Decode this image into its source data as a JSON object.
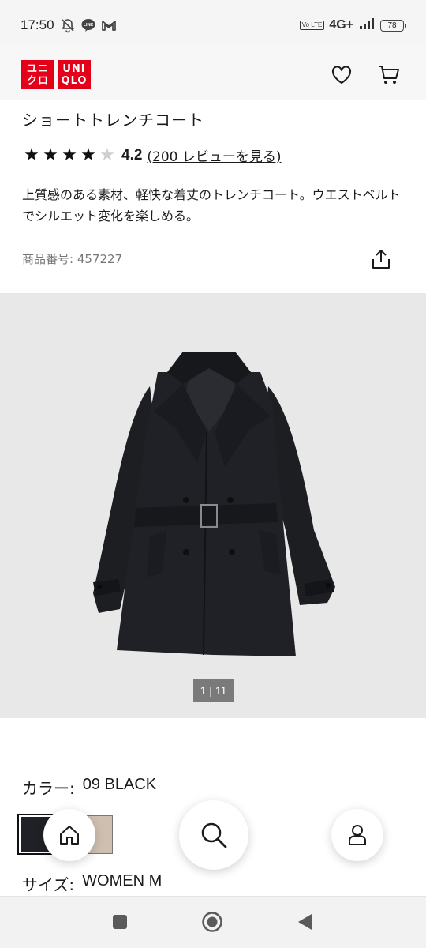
{
  "status_bar": {
    "time": "17:50",
    "network": "4G+",
    "volte": "Vo LTE",
    "battery": "78"
  },
  "header": {
    "logo": {
      "line1": "ユニ",
      "line2": "クロ",
      "line3": "UNI",
      "line4": "QLO",
      "color": "#e5001a"
    },
    "icons": [
      "heart-icon",
      "cart-icon"
    ]
  },
  "product": {
    "title": "ショートトレンチコート",
    "rating": {
      "stars_filled": 4,
      "stars_total": 5,
      "value": "4.2",
      "reviews_link": "(200 レビューを見る)"
    },
    "description": "上質感のある素材、軽快な着丈のトレンチコート。ウエストベルトでシルエット変化を楽しめる。",
    "product_number_label": "商品番号: 457227"
  },
  "gallery": {
    "counter": "1 | 11",
    "background": "#e8e8e9"
  },
  "options": {
    "color_label": "カラー:",
    "color_value": "09 BLACK",
    "swatches": [
      {
        "name": "black",
        "hex": "#1f2126",
        "selected": true
      },
      {
        "name": "beige",
        "hex": "#cfbfb1",
        "selected": false
      }
    ],
    "size_label": "サイズ:",
    "size_value": "WOMEN M"
  },
  "floating_nav": [
    "home-icon",
    "search-icon",
    "account-icon"
  ],
  "system_nav": [
    "recents-icon",
    "home-circle-icon",
    "back-icon"
  ]
}
